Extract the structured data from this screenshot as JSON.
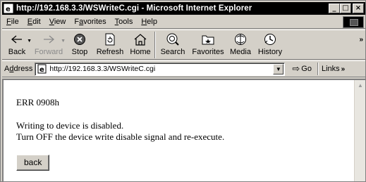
{
  "window": {
    "title": "http://192.168.3.3/WSWriteC.cgi - Microsoft Internet Explorer",
    "minimize": "_",
    "maximize": "□",
    "close": "×"
  },
  "menu": [
    "File",
    "Edit",
    "View",
    "Favorites",
    "Tools",
    "Help"
  ],
  "menu_mnemonics": [
    "F",
    "E",
    "V",
    "a",
    "T",
    "H"
  ],
  "toolbar": {
    "back": "Back",
    "forward": "Forward",
    "stop": "Stop",
    "refresh": "Refresh",
    "home": "Home",
    "search": "Search",
    "favorites": "Favorites",
    "media": "Media",
    "history": "History"
  },
  "address": {
    "label": "Address",
    "url": "http://192.168.3.3/WSWriteC.cgi",
    "go": "Go",
    "links": "Links"
  },
  "page": {
    "error_code": "ERR 0908h",
    "message_line1": "Writing to device is disabled.",
    "message_line2": "Turn OFF the device write disable signal and re-execute.",
    "back_button": "back"
  }
}
